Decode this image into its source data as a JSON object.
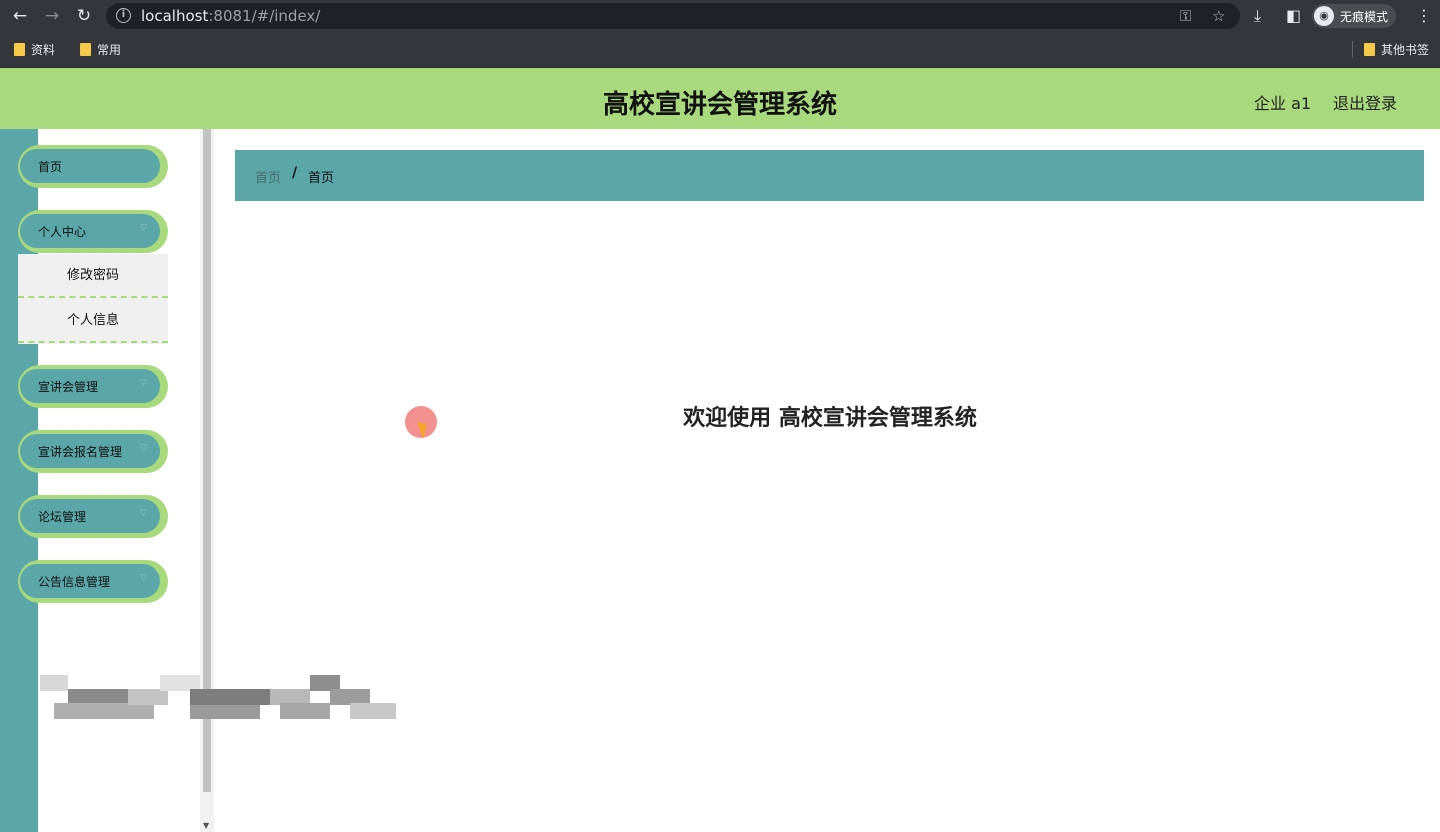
{
  "browser": {
    "url_host": "localhost",
    "url_rest": ":8081/#/index/",
    "incognito_label": "无痕模式",
    "bookmarks": [
      "资料",
      "常用"
    ],
    "other_bookmarks": "其他书签"
  },
  "header": {
    "title": "高校宣讲会管理系统",
    "user": "企业 a1",
    "logout": "退出登录"
  },
  "sidebar": {
    "items": [
      {
        "label": "首页"
      },
      {
        "label": "个人中心"
      },
      {
        "label": "宣讲会管理"
      },
      {
        "label": "宣讲会报名管理"
      },
      {
        "label": "论坛管理"
      },
      {
        "label": "公告信息管理"
      }
    ],
    "submenu": [
      "修改密码",
      "个人信息"
    ]
  },
  "breadcrumb": {
    "home": "首页",
    "separator": "/",
    "current": "首页"
  },
  "main": {
    "welcome": "欢迎使用 高校宣讲会管理系统"
  },
  "colors": {
    "header_bg": "#a8d97c",
    "teal": "#5aa6a8"
  }
}
